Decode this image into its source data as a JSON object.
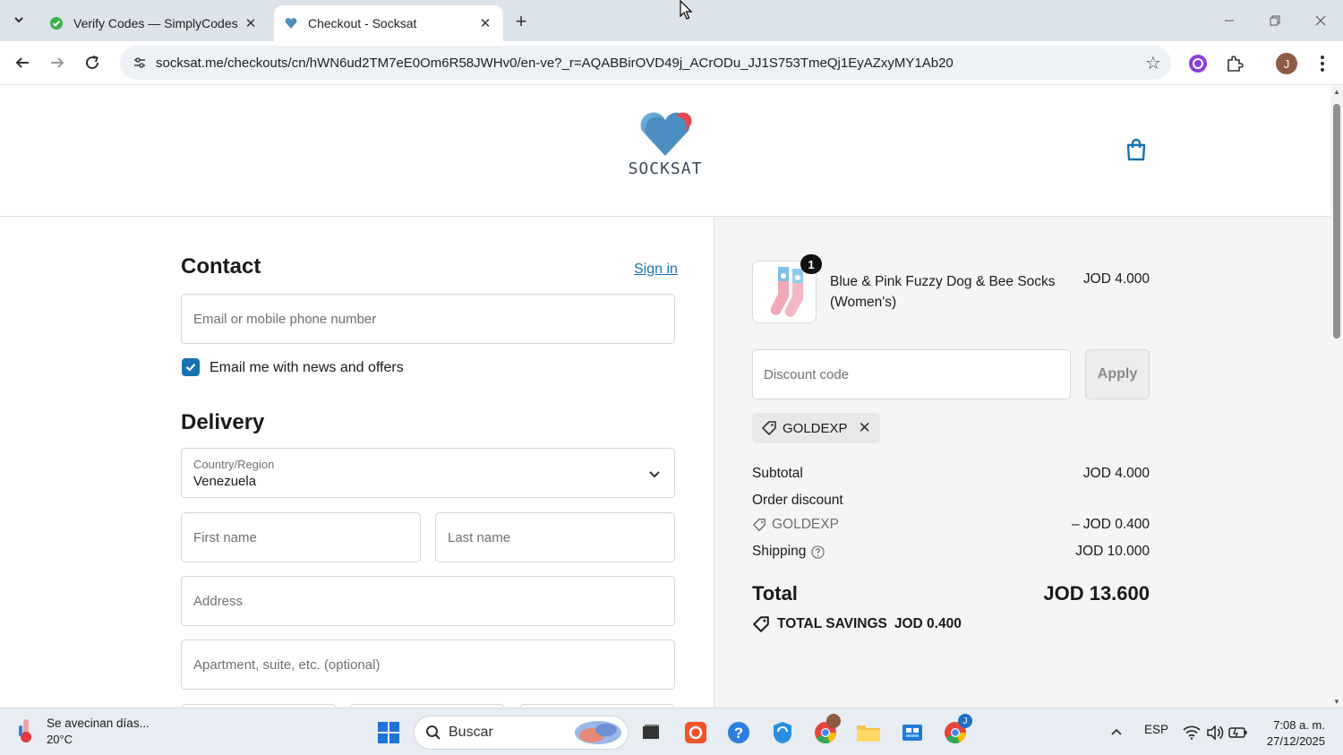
{
  "browser": {
    "tabs": [
      {
        "title": "Verify Codes — SimplyCodes",
        "active": false
      },
      {
        "title": "Checkout - Socksat",
        "active": true
      }
    ],
    "url": "socksat.me/checkouts/cn/hWN6ud2TM7eE0Om6R58JWHv0/en-ve?_r=AQABBirOVD49j_ACrODu_JJ1S753TmeQj1EyAZxyMY1Ab20",
    "profile_initial": "J"
  },
  "store": {
    "logo_text": "SOCKSAT"
  },
  "contact": {
    "heading": "Contact",
    "sign_in": "Sign in",
    "email_placeholder": "Email or mobile phone number",
    "newsletter_label": "Email me with news and offers",
    "newsletter_checked": true
  },
  "delivery": {
    "heading": "Delivery",
    "country_label": "Country/Region",
    "country_value": "Venezuela",
    "first_name_placeholder": "First name",
    "last_name_placeholder": "Last name",
    "address_placeholder": "Address",
    "apartment_placeholder": "Apartment, suite, etc. (optional)"
  },
  "summary": {
    "item": {
      "name": "Blue & Pink Fuzzy Dog & Bee Socks (Women's)",
      "quantity": "1",
      "price": "JOD 4.000"
    },
    "discount_placeholder": "Discount code",
    "apply_label": "Apply",
    "applied_code": "GOLDEXP",
    "subtotal_label": "Subtotal",
    "subtotal_value": "JOD 4.000",
    "order_discount_label": "Order discount",
    "discount_code": "GOLDEXP",
    "discount_value": "– JOD 0.400",
    "shipping_label": "Shipping",
    "shipping_value": "JOD 10.000",
    "total_label": "Total",
    "total_value": "JOD 13.600",
    "savings_label": "TOTAL SAVINGS",
    "savings_value": "JOD 0.400"
  },
  "taskbar": {
    "weather_text": "Se avecinan días...",
    "temperature": "20°C",
    "search_placeholder": "Buscar",
    "language": "ESP",
    "time": "7:08 a. m.",
    "date": "27/12/2025",
    "chrome_badge": "J"
  },
  "colors": {
    "accent": "#1773b0",
    "summary_bg": "#f5f5f5",
    "tabbar_bg": "#dde3ea"
  }
}
